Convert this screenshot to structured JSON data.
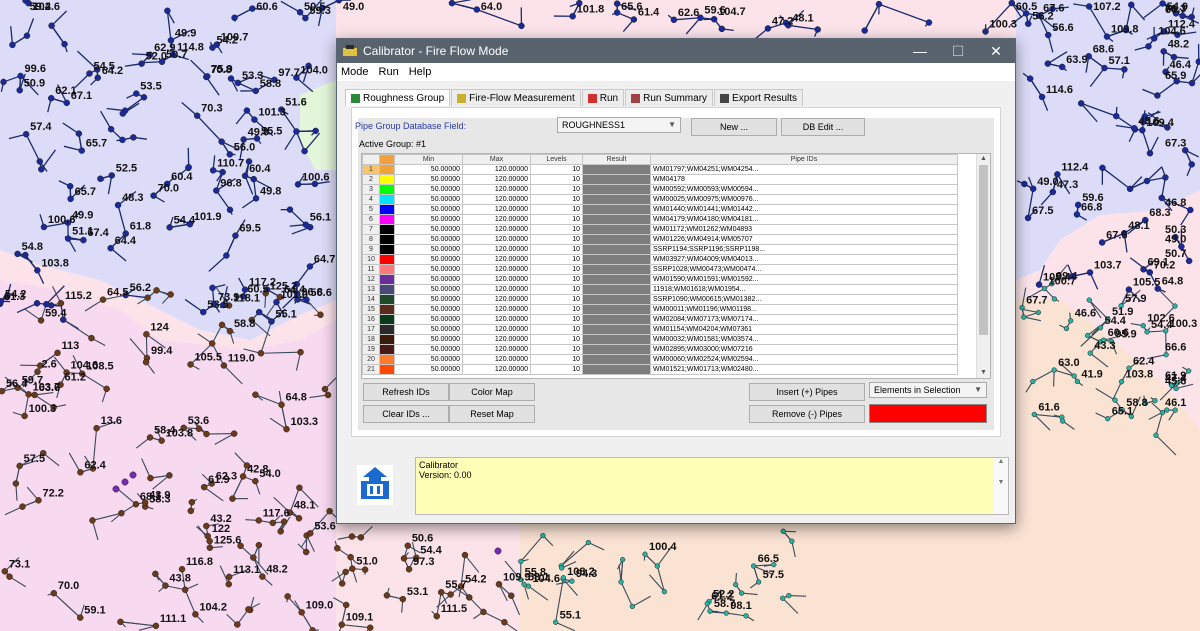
{
  "window": {
    "title": "Calibrator - Fire Flow Mode",
    "minimize": "—",
    "maximize": "☐",
    "close": "✕"
  },
  "menu": [
    "Mode",
    "Run",
    "Help"
  ],
  "tabs": [
    "Roughness Group",
    "Fire-Flow Measurement",
    "Run",
    "Run Summary",
    "Export Results"
  ],
  "form": {
    "db_field_label": "Pipe Group Database Field:",
    "db_field_value": "ROUGHNESS1",
    "new_button": "New ...",
    "db_edit_button": "DB Edit ...",
    "active_group_label": "Active Group: #1"
  },
  "grid": {
    "columns": [
      "",
      "",
      "Min",
      "Max",
      "Levels",
      "Result",
      "Pipe IDs"
    ],
    "rows": [
      {
        "n": "1",
        "color": "#f2a23a",
        "min": "50.00000",
        "max": "120.00000",
        "levels": "10",
        "ids": "WM01797;WM04251;WM04254..."
      },
      {
        "n": "2",
        "color": "#ffff00",
        "min": "50.00000",
        "max": "120.00000",
        "levels": "10",
        "ids": "WM04178"
      },
      {
        "n": "3",
        "color": "#00ff00",
        "min": "50.00000",
        "max": "120.00000",
        "levels": "10",
        "ids": "WM00592;WM00593;WM00594..."
      },
      {
        "n": "4",
        "color": "#00e0ff",
        "min": "50.00000",
        "max": "120.00000",
        "levels": "10",
        "ids": "WM00025;WM00975;WM00976..."
      },
      {
        "n": "5",
        "color": "#0000ff",
        "min": "50.00000",
        "max": "120.00000",
        "levels": "10",
        "ids": "WM01440;WM01441;WM01442..."
      },
      {
        "n": "6",
        "color": "#ff00ff",
        "min": "50.00000",
        "max": "120.00000",
        "levels": "10",
        "ids": "WM04179;WM04180;WM04181..."
      },
      {
        "n": "7",
        "color": "#000000",
        "min": "50.00000",
        "max": "120.00000",
        "levels": "10",
        "ids": "WM01172;WM01262;WM04893"
      },
      {
        "n": "8",
        "color": "#000000",
        "min": "50.00000",
        "max": "120.00000",
        "levels": "10",
        "ids": "WM01226;WM04914;WM05707"
      },
      {
        "n": "9",
        "color": "#000000",
        "min": "50.00000",
        "max": "120.00000",
        "levels": "10",
        "ids": "SSRP1194;SSRP1196;SSRP1198..."
      },
      {
        "n": "10",
        "color": "#ff0000",
        "min": "50.00000",
        "max": "120.00000",
        "levels": "10",
        "ids": "WM03927;WM04009;WM04013..."
      },
      {
        "n": "11",
        "color": "#ff7b7b",
        "min": "50.00000",
        "max": "120.00000",
        "levels": "10",
        "ids": "SSRP1028;WM00473;WM00474..."
      },
      {
        "n": "12",
        "color": "#6a2d9a",
        "min": "50.00000",
        "max": "120.00000",
        "levels": "10",
        "ids": "WM01590;WM01591;WM01592..."
      },
      {
        "n": "13",
        "color": "#4a4a7a",
        "min": "50.00000",
        "max": "120.00000",
        "levels": "10",
        "ids": "11918;WM01618;WM01954..."
      },
      {
        "n": "14",
        "color": "#1e4a2a",
        "min": "50.00000",
        "max": "120.00000",
        "levels": "10",
        "ids": "SSRP1090;WM00615;WM01382..."
      },
      {
        "n": "15",
        "color": "#5a2a1a",
        "min": "50.00000",
        "max": "120.00000",
        "levels": "10",
        "ids": "WM00011;WM01196;WM01198..."
      },
      {
        "n": "16",
        "color": "#0a3a1a",
        "min": "50.00000",
        "max": "120.00000",
        "levels": "10",
        "ids": "WM02084;WM07173;WM07174..."
      },
      {
        "n": "17",
        "color": "#2a2a2a",
        "min": "50.00000",
        "max": "120.00000",
        "levels": "10",
        "ids": "WM01154;WM04204;WM07361"
      },
      {
        "n": "18",
        "color": "#3a1a0a",
        "min": "50.00000",
        "max": "120.00000",
        "levels": "10",
        "ids": "WM00032;WM01581;WM03574..."
      },
      {
        "n": "19",
        "color": "#4a1a1a",
        "min": "50.00000",
        "max": "120.00000",
        "levels": "10",
        "ids": "WM02895;WM03000;WM07216"
      },
      {
        "n": "20",
        "color": "#ff7b2a",
        "min": "50.00000",
        "max": "120.00000",
        "levels": "10",
        "ids": "WM00060;WM02524;WM02594..."
      },
      {
        "n": "21",
        "color": "#ff4a00",
        "min": "50.00000",
        "max": "120.00000",
        "levels": "10",
        "ids": "WM01521;WM01713;WM02480..."
      }
    ]
  },
  "buttons": {
    "refresh_ids": "Refresh IDs",
    "color_map": "Color Map",
    "clear_ids": "Clear IDs ...",
    "reset_map": "Reset Map",
    "insert_pipes": "Insert (+) Pipes",
    "remove_pipes": "Remove (-) Pipes",
    "elements_select": "Elements in Selection",
    "color_swatch": "#ff0000"
  },
  "message": {
    "line1": "Calibrator",
    "line2": "Version: 0.00"
  },
  "map_labels": [
    "61.3",
    "61.8",
    "56.6",
    "50.9",
    "53.5",
    "54.4",
    "57.4",
    "58.8",
    "56.2",
    "54.5",
    "50.5",
    "48.3",
    "60.4",
    "60.6",
    "56.1",
    "53.5",
    "55.1",
    "60.5",
    "62.6",
    "64.0",
    "68.6",
    "69.1",
    "66.8",
    "63.9",
    "67.3",
    "66.7",
    "57.1",
    "64.8",
    "56.2",
    "54.0",
    "54.4",
    "54.4",
    "58.8",
    "51.9",
    "57.9",
    "60.6",
    "61.9",
    "63.6",
    "64.5",
    "62.3",
    "58.4",
    "58.3",
    "59.7",
    "73.1",
    "72.2",
    "70.0",
    "64.8",
    "64.4",
    "57.5",
    "53.6",
    "53.6",
    "54.0",
    "51.0",
    "58.0",
    "50.6",
    "49.3",
    "52.2",
    "57.5",
    "55.8",
    "66.5",
    "64.4",
    "64.7",
    "62.1",
    "59.3",
    "70.8",
    "70.3",
    "70.0",
    "75.9",
    "73.9",
    "69.5",
    "67.4",
    "67.1",
    "62.9",
    "64.2",
    "60.5",
    "65.7",
    "65.7",
    "65.6",
    "61.4",
    "59.6",
    "59.6",
    "56.6",
    "68.3",
    "71.3",
    "70.2",
    "65.9",
    "67.6",
    "67.5",
    "67.6",
    "67.7",
    "65.1",
    "66.6",
    "63.0",
    "62.4",
    "61.9",
    "61.6",
    "58.8",
    "62.4",
    "118.1",
    "63.7",
    "103.7",
    "109.0",
    "119.0",
    "115.2",
    "117.6",
    "111.1",
    "116.8",
    "113.1",
    "108.5",
    "103.3",
    "103.8",
    "111.5",
    "97.3",
    "109.9",
    "109.1",
    "108.2",
    "100.4",
    "98.1",
    "94.3",
    "104.6",
    "97.7",
    "96.8",
    "117.2",
    "114.8",
    "110.7",
    "103.8",
    "96.8",
    "104.0",
    "101.9",
    "100.6",
    "100.6",
    "100.7",
    "101.3",
    "101.0",
    "102.6",
    "99.6",
    "104.7",
    "101.8",
    "100.3",
    "109.4",
    "107.2",
    "104.6",
    "112.4",
    "112.4",
    "105.4",
    "114.6",
    "105.5",
    "109.8",
    "103.7",
    "100.3",
    "102.6",
    "99.4",
    "95.9",
    "103.8",
    "100.7",
    "99.4",
    "97.7",
    "104.2",
    "105.5",
    "104.6",
    "100.3",
    "68.1",
    "125.6",
    "125.2",
    "122",
    "113",
    "124",
    "59.4",
    "61.2",
    "59.1",
    "56.4",
    "53.1",
    "55.7",
    "54.4",
    "54.2",
    "55.1",
    "58.7",
    "58.1",
    "61.2",
    "60.4",
    "56.0",
    "51.6",
    "52.0",
    "52.5",
    "53.3",
    "54.2",
    "59.4",
    "54.2",
    "54.8",
    "55.5",
    "49.0",
    "50.7",
    "51.1",
    "49.8",
    "49.9",
    "49.9",
    "49.0",
    "48.1",
    "47.2",
    "49.0",
    "46.8",
    "48.1",
    "46.4",
    "50.3",
    "50.7",
    "49.0",
    "48.2",
    "47.3",
    "48.6",
    "45.6",
    "47.4",
    "46.1",
    "46.6",
    "41.9",
    "43.3",
    "43.8",
    "42.8",
    "43.2",
    "48.1",
    "48.2",
    "43.9",
    "2.6",
    "51.3",
    "13.6"
  ]
}
